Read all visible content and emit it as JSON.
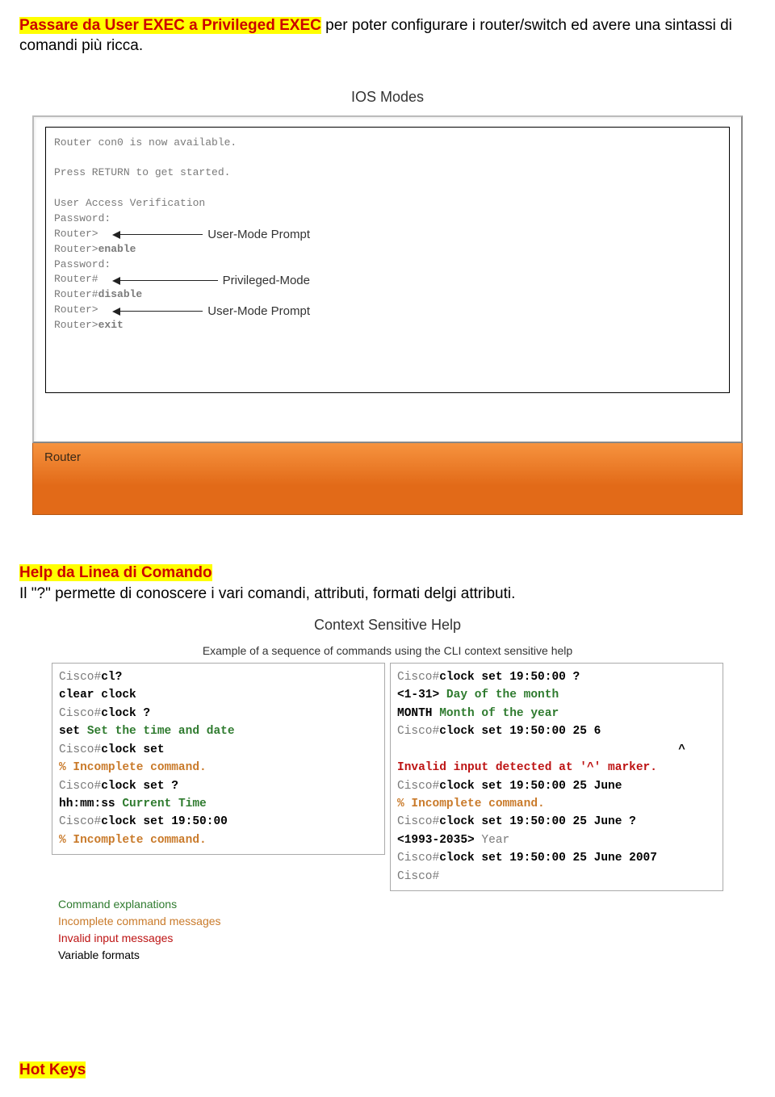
{
  "intro": {
    "hl_text": "Passare da User EXEC a Privileged EXEC",
    "rest": " per poter configurare i router/switch ed avere una sintassi di comandi più ricca."
  },
  "fig1": {
    "title": "IOS Modes",
    "lines": {
      "l1": "Router con0 is now available.",
      "l2": "Press RETURN to get started.",
      "l3": "User Access Verification",
      "l4": "Password:",
      "l5a": "Router>",
      "l6a": "Router>",
      "l6b": "enable",
      "l7": "Password:",
      "l8a": "Router#",
      "l9a": "Router#",
      "l9b": "disable",
      "l10a": "Router>",
      "l11a": "Router>",
      "l11b": "exit"
    },
    "labels": {
      "a1": "User-Mode Prompt",
      "a2": "Privileged-Mode",
      "a3": "User-Mode Prompt"
    },
    "bar": "Router"
  },
  "sec2": {
    "heading": "Help da Linea di Comando",
    "para": "Il \"?\" permette di conoscere i vari comandi, attributi, formati delgi attributi.",
    "title": "Context Sensitive Help",
    "subtitle": "Example of a sequence of commands using the CLI context sensitive help"
  },
  "left": {
    "l1a": "Cisco#",
    "l1b": "cl?",
    "l2": "clear  clock",
    "l3a": "Cisco#",
    "l3b": "clock ?",
    "l4a": "  set  ",
    "l4b": "Set the time and date",
    "l5a": "Cisco#",
    "l5b": "clock set",
    "l6": "% Incomplete command.",
    "l7a": "Cisco#",
    "l7b": "clock set ?",
    "l8a": "  hh:mm:ss  ",
    "l8b": "Current Time",
    "l9a": "Cisco#",
    "l9b": "clock set 19:50:00",
    "l10": "% Incomplete command."
  },
  "right": {
    "r1a": "Cisco#",
    "r1b": "clock set 19:50:00 ?",
    "r2a": "  <1-31>  ",
    "r2b": "Day of the month",
    "r3a": "  MONTH   ",
    "r3b": "Month of the year",
    "r4a": "Cisco#",
    "r4b": "clock set 19:50:00 25 6",
    "r5": "^",
    "r6": "Invalid input detected at '^' marker.",
    "r7a": "Cisco#",
    "r7b": "clock set 19:50:00 25 June",
    "r8": "% Incomplete command.",
    "r9a": "Cisco#",
    "r9b": "clock set 19:50:00 25 June ?",
    "r10a": "  <1993-2035>  ",
    "r10b": "Year",
    "r11a": "Cisco#",
    "r11b": "clock set 19:50:00 25 June 2007",
    "r12a": "Cisco#"
  },
  "legend": {
    "a": "Command explanations",
    "b": "Incomplete command messages",
    "c": "Invalid input messages",
    "d": "Variable formats"
  },
  "hotkeys": "Hot Keys"
}
